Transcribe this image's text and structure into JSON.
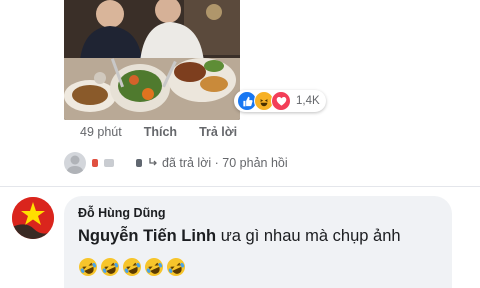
{
  "post_image": {
    "icon": "photo-of-two-people-with-food"
  },
  "reactions": {
    "icons": [
      "like-icon",
      "haha-icon",
      "love-icon"
    ],
    "count": "1,4K"
  },
  "comment_meta": {
    "time": "49 phút",
    "like_label": "Thích",
    "reply_label": "Trả lời"
  },
  "reply_summary": {
    "text": "đã trả lời · 70 phản hồi"
  },
  "reply": {
    "author": "Đỗ Hùng Dũng",
    "tagged_name": "Nguyễn Tiến Linh",
    "text": " ưa gì nhau mà chụp ảnh",
    "emoji_count": 5
  },
  "colors": {
    "like": "#1877f2",
    "haha": "#f7b125",
    "love": "#f33e58",
    "bubble": "#f0f2f5",
    "meta": "#65676b"
  }
}
